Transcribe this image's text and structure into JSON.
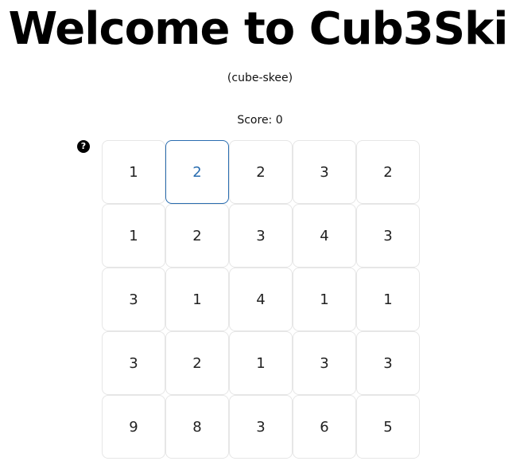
{
  "header": {
    "title": "Welcome to Cub3Ski",
    "pronunciation": "(cube-skee)"
  },
  "score": {
    "text": "Score: 0",
    "value": 0
  },
  "help": {
    "icon": "question-circle-icon",
    "glyph": "?"
  },
  "board": {
    "selected_row": 0,
    "selected_col": 1,
    "accent_color": "#2a6db0",
    "rows": [
      [
        "1",
        "2",
        "2",
        "3",
        "2"
      ],
      [
        "1",
        "2",
        "3",
        "4",
        "3"
      ],
      [
        "3",
        "1",
        "4",
        "1",
        "1"
      ],
      [
        "3",
        "2",
        "1",
        "3",
        "3"
      ],
      [
        "9",
        "8",
        "3",
        "6",
        "5"
      ]
    ]
  }
}
